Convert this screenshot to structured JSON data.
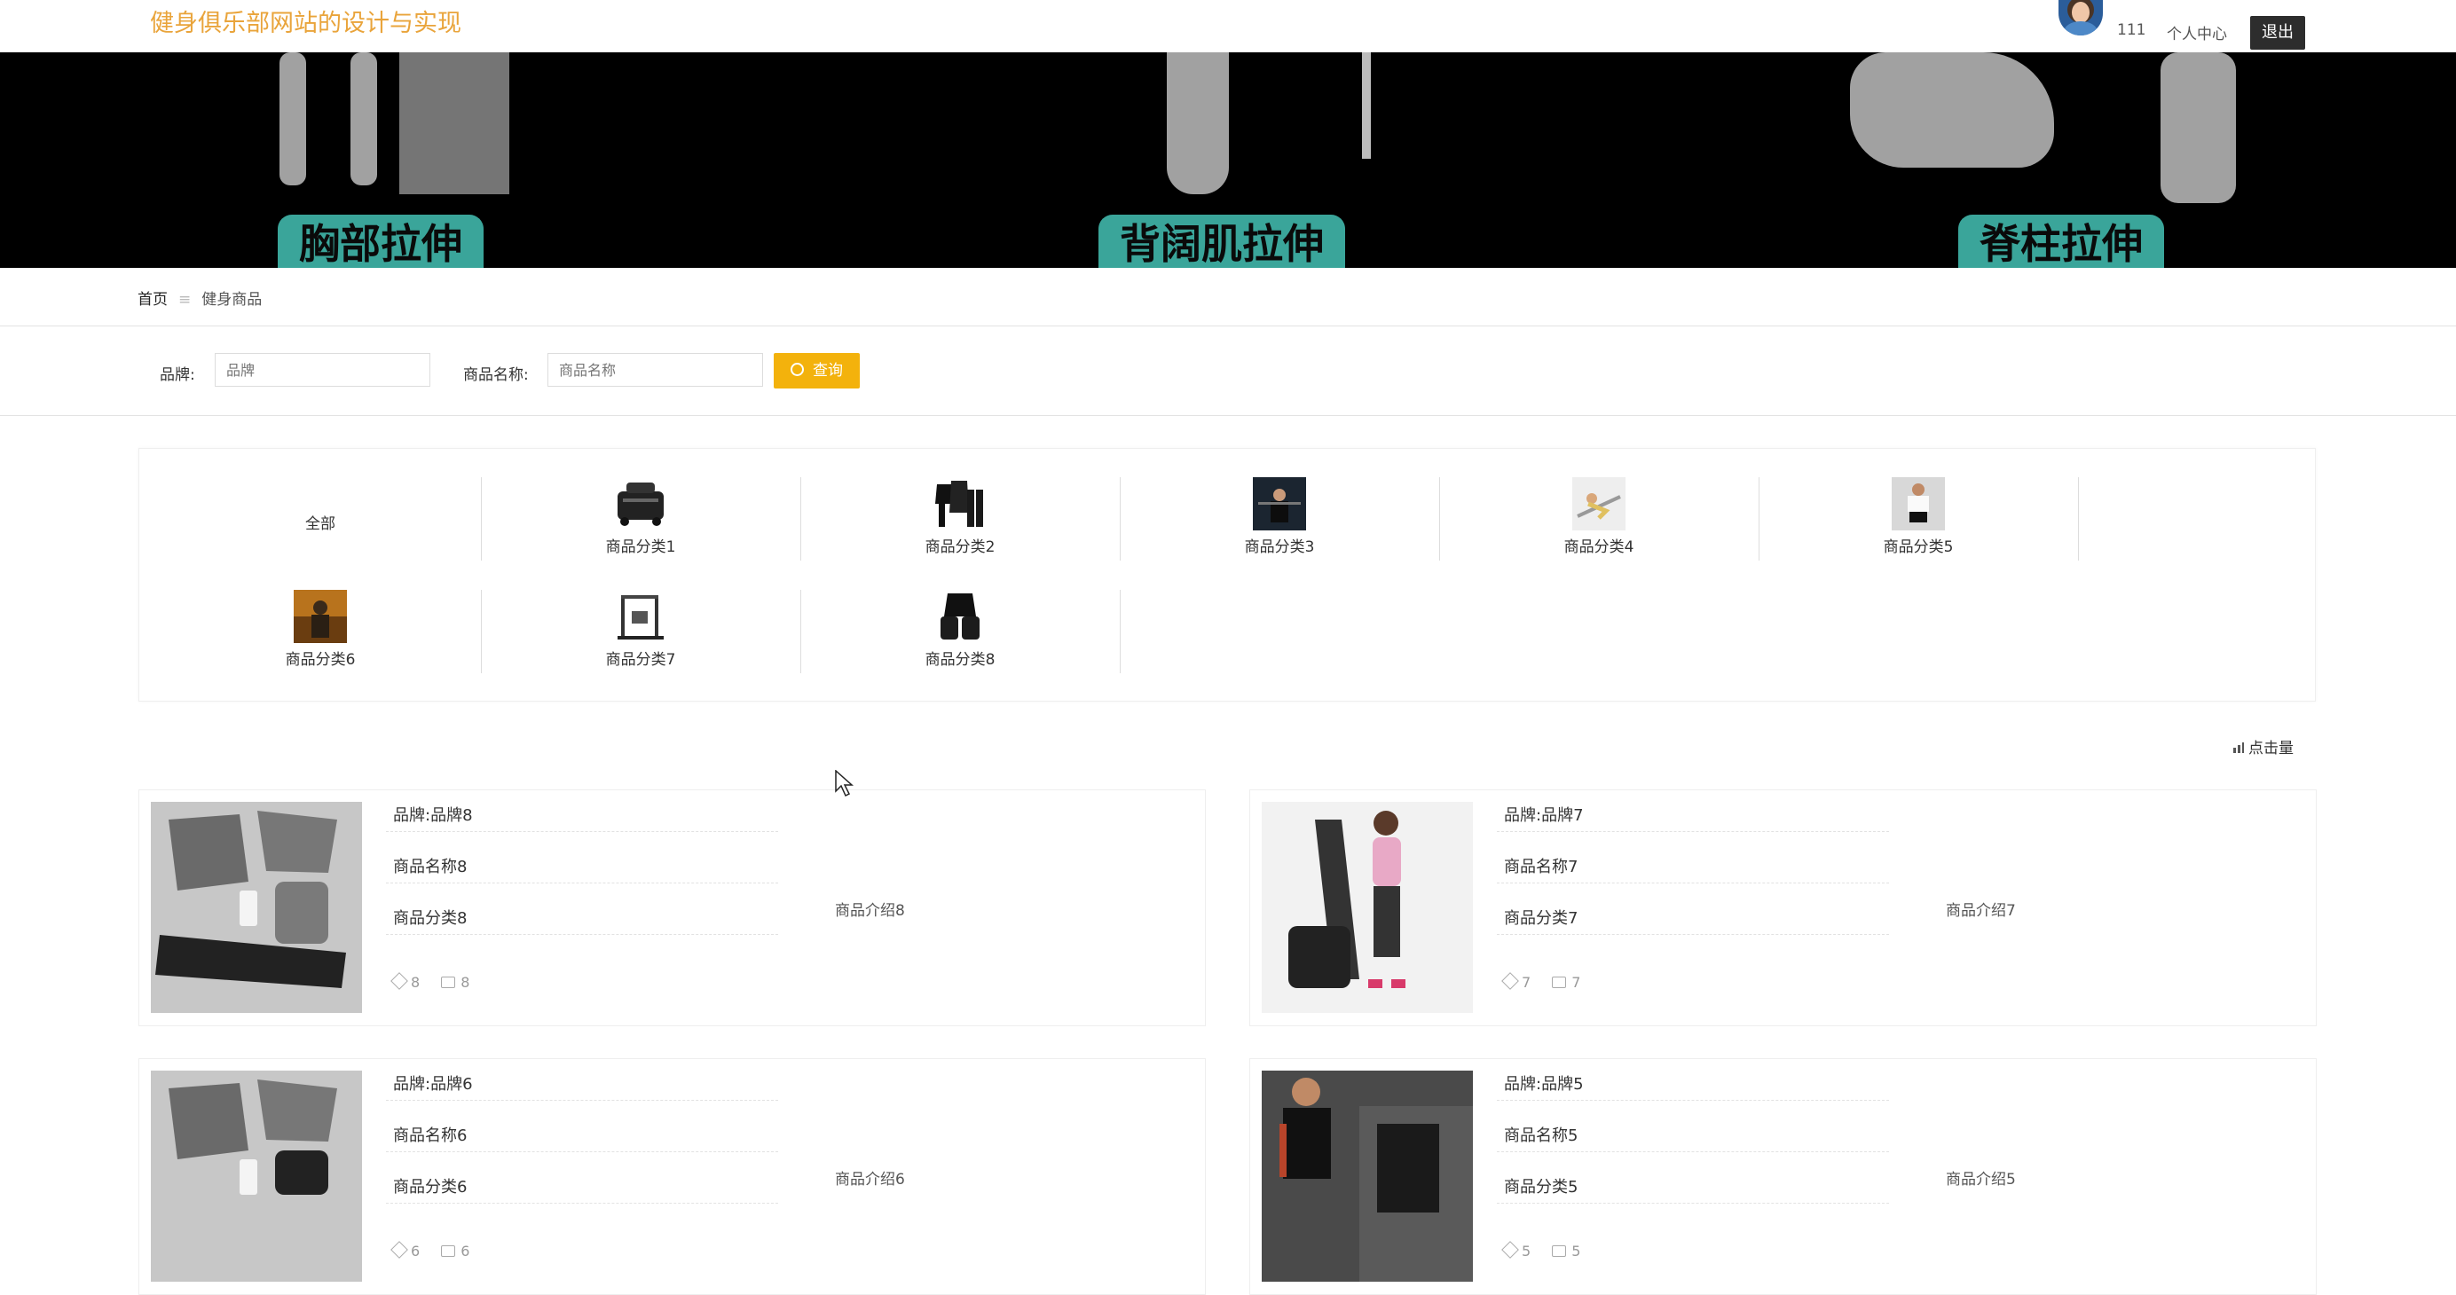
{
  "header": {
    "site_title": "健身俱乐部网站的设计与实现",
    "username": "111",
    "personal_center": "个人中心",
    "logout": "退出"
  },
  "banner": {
    "labels": [
      "胸部拉伸",
      "背阔肌拉伸",
      "脊柱拉伸"
    ]
  },
  "breadcrumb": {
    "home": "首页",
    "separator": "≡",
    "current": "健身商品"
  },
  "search": {
    "brand_label": "品牌:",
    "brand_placeholder": "品牌",
    "name_label": "商品名称:",
    "name_placeholder": "商品名称",
    "button": "查询"
  },
  "categories": {
    "all": "全部",
    "items": [
      "商品分类1",
      "商品分类2",
      "商品分类3",
      "商品分类4",
      "商品分类5",
      "商品分类6",
      "商品分类7",
      "商品分类8"
    ]
  },
  "sort": {
    "label": "点击量"
  },
  "products": [
    {
      "brand": "品牌:品牌8",
      "name": "商品名称8",
      "category": "商品分类8",
      "intro": "商品介绍8",
      "likes": "8",
      "comments": "8"
    },
    {
      "brand": "品牌:品牌7",
      "name": "商品名称7",
      "category": "商品分类7",
      "intro": "商品介绍7",
      "likes": "7",
      "comments": "7"
    },
    {
      "brand": "品牌:品牌6",
      "name": "商品名称6",
      "category": "商品分类6",
      "intro": "商品介绍6",
      "likes": "6",
      "comments": "6"
    },
    {
      "brand": "品牌:品牌5",
      "name": "商品名称5",
      "category": "商品分类5",
      "intro": "商品介绍5",
      "likes": "5",
      "comments": "5"
    }
  ],
  "colors": {
    "accent": "#f3b20c",
    "title": "#e9a43b",
    "banner_label": "#3aa59a"
  }
}
